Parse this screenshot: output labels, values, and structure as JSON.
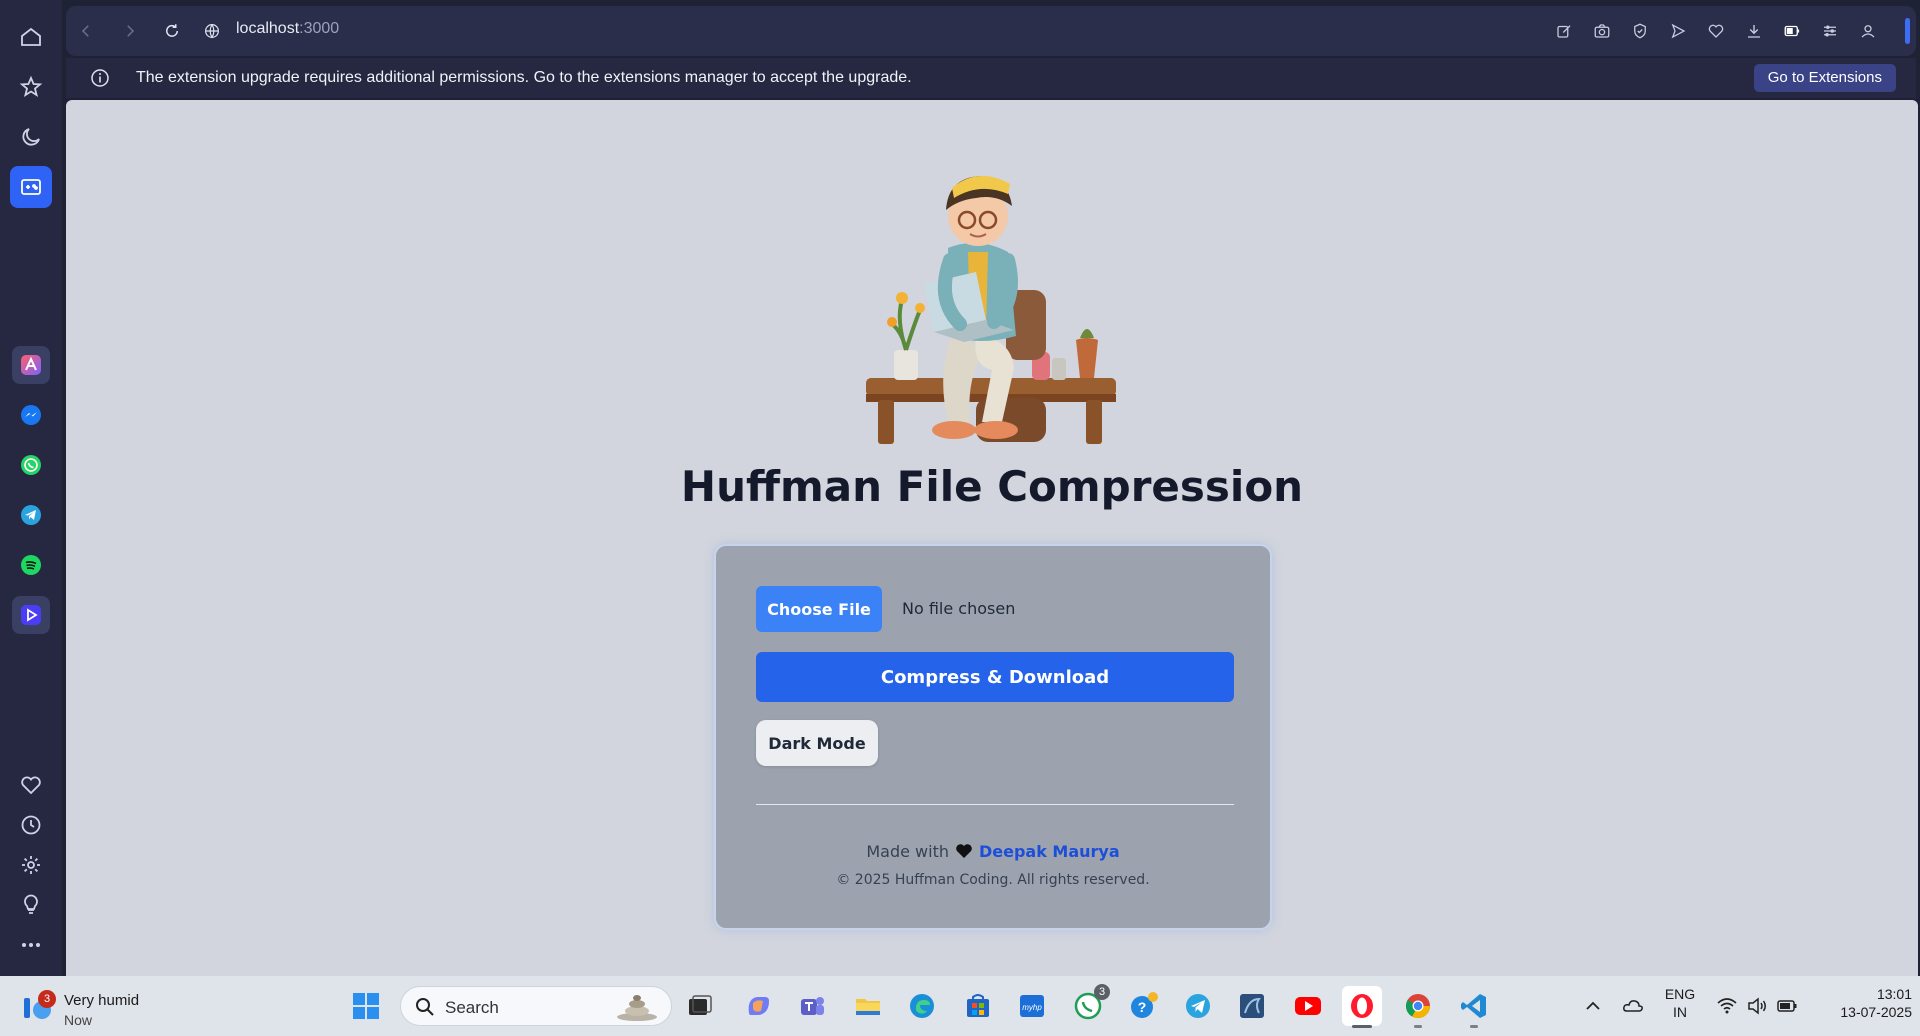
{
  "browser": {
    "url_host": "localhost",
    "url_port": ":3000"
  },
  "notification": {
    "message": "The extension upgrade requires additional permissions. Go to the extensions manager to accept the upgrade.",
    "action_label": "Go to Extensions"
  },
  "page": {
    "title": "Huffman File Compression",
    "choose_file_label": "Choose File",
    "file_status": "No file chosen",
    "compress_label": "Compress & Download",
    "dark_mode_label": "Dark Mode",
    "made_with_text": "Made with",
    "author": "Deepak Maurya",
    "copyright": "© 2025 Huffman Coding. All rights reserved."
  },
  "taskbar": {
    "weather_title": "Very humid",
    "weather_sub": "Now",
    "weather_badge": "3",
    "search_placeholder": "Search",
    "whatsapp_badge": "3",
    "lang_line1": "ENG",
    "lang_line2": "IN",
    "time": "13:01",
    "date": "13-07-2025"
  },
  "colors": {
    "accent_blue": "#2563eb",
    "choose_blue": "#3b82f6",
    "card_bg": "#9ca3af",
    "viewport_bg": "#d2d5dd",
    "browser_chrome": "#252840"
  }
}
